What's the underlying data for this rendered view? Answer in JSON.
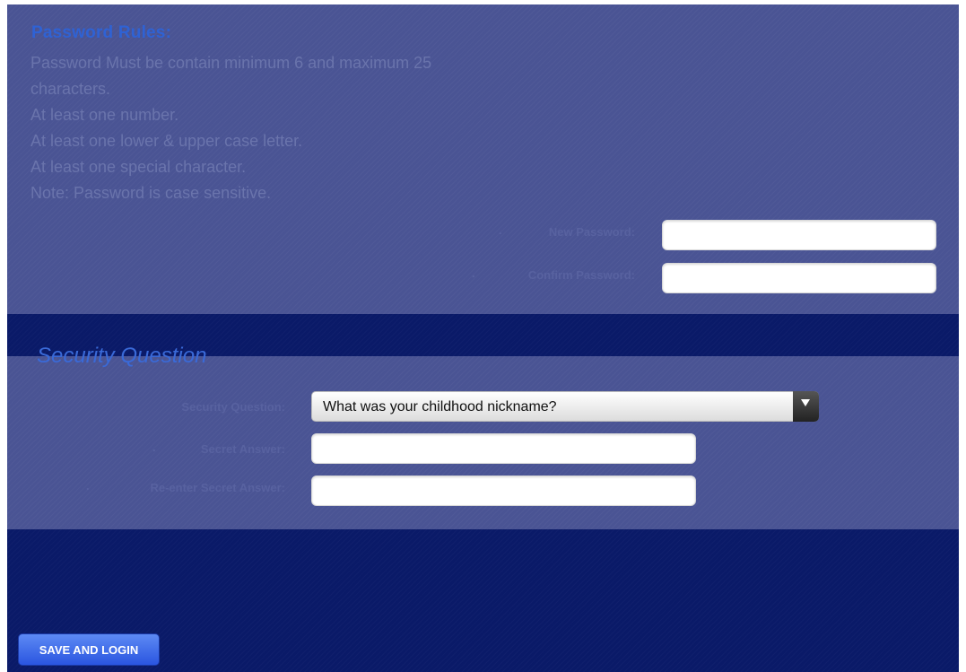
{
  "password_rules": {
    "title": "Password Rules:",
    "lines": [
      "Password Must be contain minimum 6 and maximum 25",
      "characters.",
      "At least one number.",
      "At least one lower & upper case letter.",
      "At least one special character.",
      "Note: Password is case sensitive."
    ]
  },
  "password_form": {
    "required_mark": ".",
    "new_password_label": "New Password:",
    "new_password_value": "",
    "confirm_password_label": "Confirm Password:",
    "confirm_password_value": ""
  },
  "security_section": {
    "title": "Security Question",
    "question_label": "Security Question:",
    "question_selected": "What was your childhood nickname?",
    "required_mark": ".",
    "answer_label": "Secret Answer:",
    "answer_value": "",
    "reenter_label": "Re-enter Secret Answer:",
    "reenter_value": ""
  },
  "actions": {
    "save_label": "SAVE AND LOGIN"
  },
  "colors": {
    "background": "#0a1a68",
    "panel": "#4a5494",
    "accent": "#2f62d4",
    "button": "#3d68ea"
  }
}
